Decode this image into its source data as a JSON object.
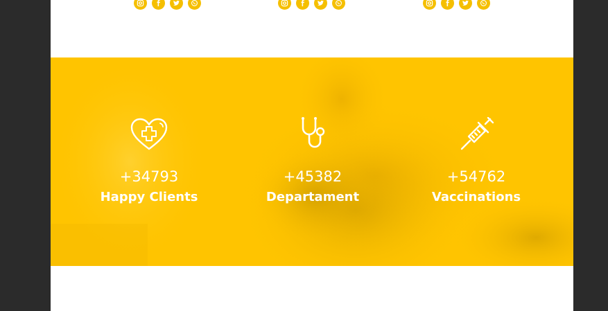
{
  "colors": {
    "brand_yellow": "#ffc400",
    "icon_yellow": "#f5bf00",
    "frame": "#2b2b2b",
    "white": "#ffffff"
  },
  "team_social": [
    {
      "icons": [
        "instagram-icon",
        "facebook-icon",
        "twitter-icon",
        "whatsapp-icon"
      ]
    },
    {
      "icons": [
        "instagram-icon",
        "facebook-icon",
        "twitter-icon",
        "whatsapp-icon"
      ]
    },
    {
      "icons": [
        "instagram-icon",
        "facebook-icon",
        "twitter-icon",
        "whatsapp-icon"
      ]
    }
  ],
  "stats": [
    {
      "icon": "heart-cross-icon",
      "number": "+34793",
      "label": "Happy Clients"
    },
    {
      "icon": "stethoscope-icon",
      "number": "+45382",
      "label": "Departament"
    },
    {
      "icon": "syringe-icon",
      "number": "+54762",
      "label": "Vaccinations"
    }
  ]
}
